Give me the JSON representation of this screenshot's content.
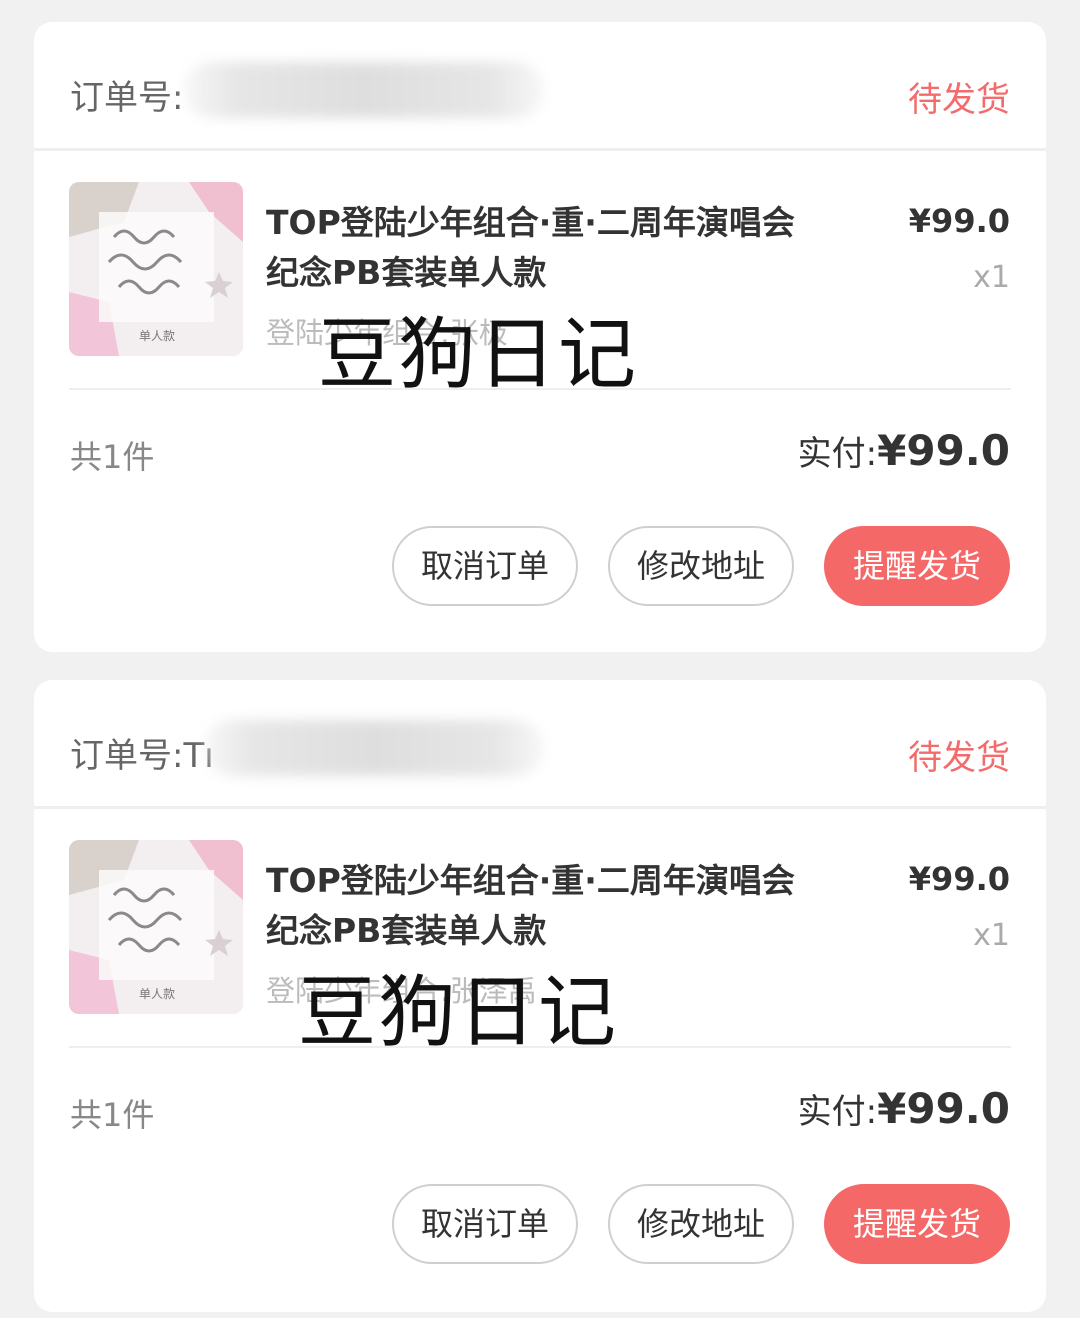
{
  "orders": [
    {
      "order_label": "订单号:",
      "status": "待发货",
      "product": {
        "title": "TOP登陆少年组合·重·二周年演唱会纪念PB套装单人款",
        "spec": "登陆少年组合:张极",
        "price": "¥99.0",
        "quantity": "x1",
        "watermark": "豆狗日记",
        "image_caption": "单人款"
      },
      "item_count": "共1件",
      "paid_label": "实付:",
      "paid_amount": "¥99.0",
      "actions": {
        "cancel": "取消订单",
        "change_address": "修改地址",
        "remind": "提醒发货"
      }
    },
    {
      "order_label": "订单号:Tı",
      "status": "待发货",
      "product": {
        "title": "TOP登陆少年组合·重·二周年演唱会纪念PB套装单人款",
        "spec": "登陆少年组合:张泽禹",
        "price": "¥99.0",
        "quantity": "x1",
        "watermark": "豆狗日记",
        "image_caption": "单人款"
      },
      "item_count": "共1件",
      "paid_label": "实付:",
      "paid_amount": "¥99.0",
      "actions": {
        "cancel": "取消订单",
        "change_address": "修改地址",
        "remind": "提醒发货"
      }
    }
  ],
  "colors": {
    "accent": "#f56868",
    "status": "#f36b6b",
    "background": "#f1f1f1"
  }
}
